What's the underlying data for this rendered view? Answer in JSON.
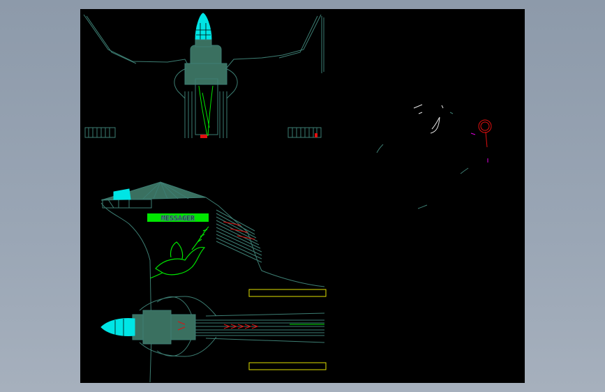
{
  "app": {
    "background_color": "#95a1b0",
    "canvas_color": "#000000"
  },
  "drawing": {
    "views": [
      {
        "id": "top-view",
        "icon": "aircraft-front-elevation"
      },
      {
        "id": "side-view",
        "icon": "aircraft-plan-view"
      },
      {
        "id": "detail-view",
        "icon": "scattered-detail-fragments"
      }
    ],
    "panel_lettering": "MESSAGER",
    "emblem": "dove-with-olive-branch",
    "colors": {
      "outline": "#3d7e73",
      "nose_cone": "#00e5e5",
      "fill": "#3a7060",
      "accent_green": "#00e600",
      "accent_red": "#e01010",
      "accent_yellow": "#e0e000",
      "accent_white": "#e8e8e8",
      "accent_magenta": "#e000e0"
    }
  }
}
